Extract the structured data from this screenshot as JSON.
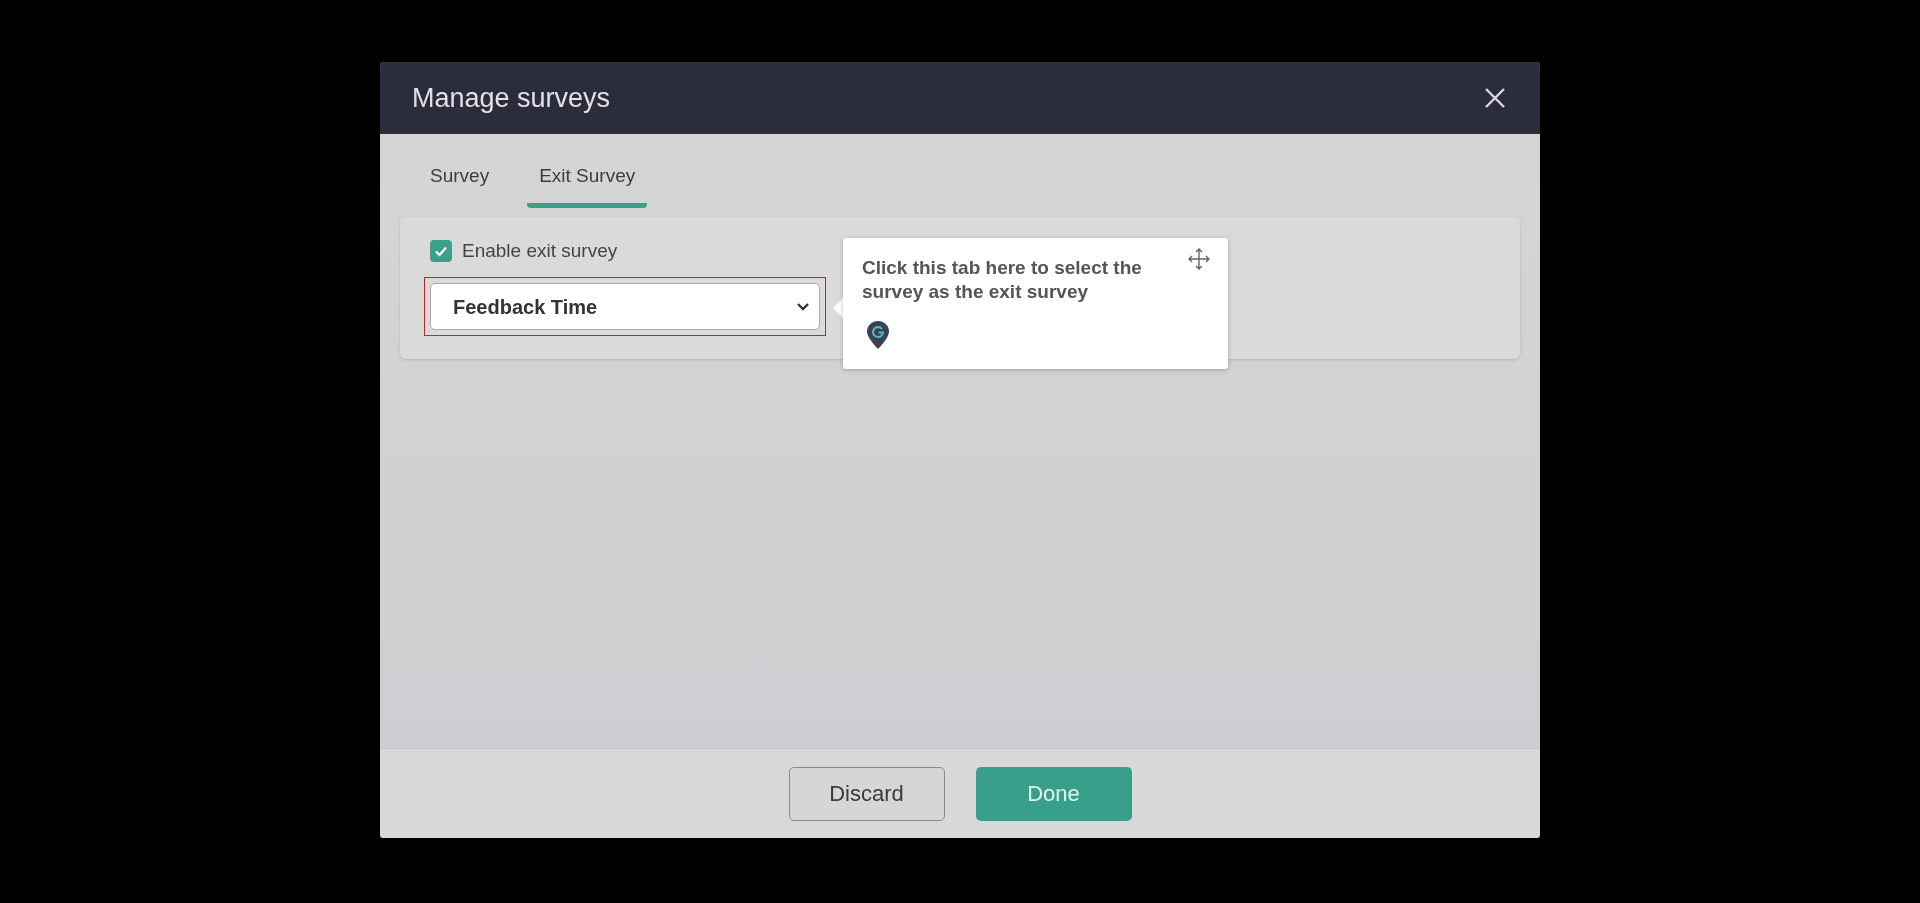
{
  "dialog": {
    "title": "Manage surveys"
  },
  "tabs": [
    {
      "label": "Survey",
      "selected": false
    },
    {
      "label": "Exit Survey",
      "selected": true
    }
  ],
  "exit_survey": {
    "checkbox": {
      "label": "Enable exit survey",
      "checked": true
    },
    "select": {
      "value": "Feedback Time"
    }
  },
  "tooltip": {
    "text": "Click this tab here to select the survey as the exit survey"
  },
  "buttons": [
    {
      "label": "Discard",
      "kind": "secondary"
    },
    {
      "label": "Done",
      "kind": "primary"
    }
  ]
}
